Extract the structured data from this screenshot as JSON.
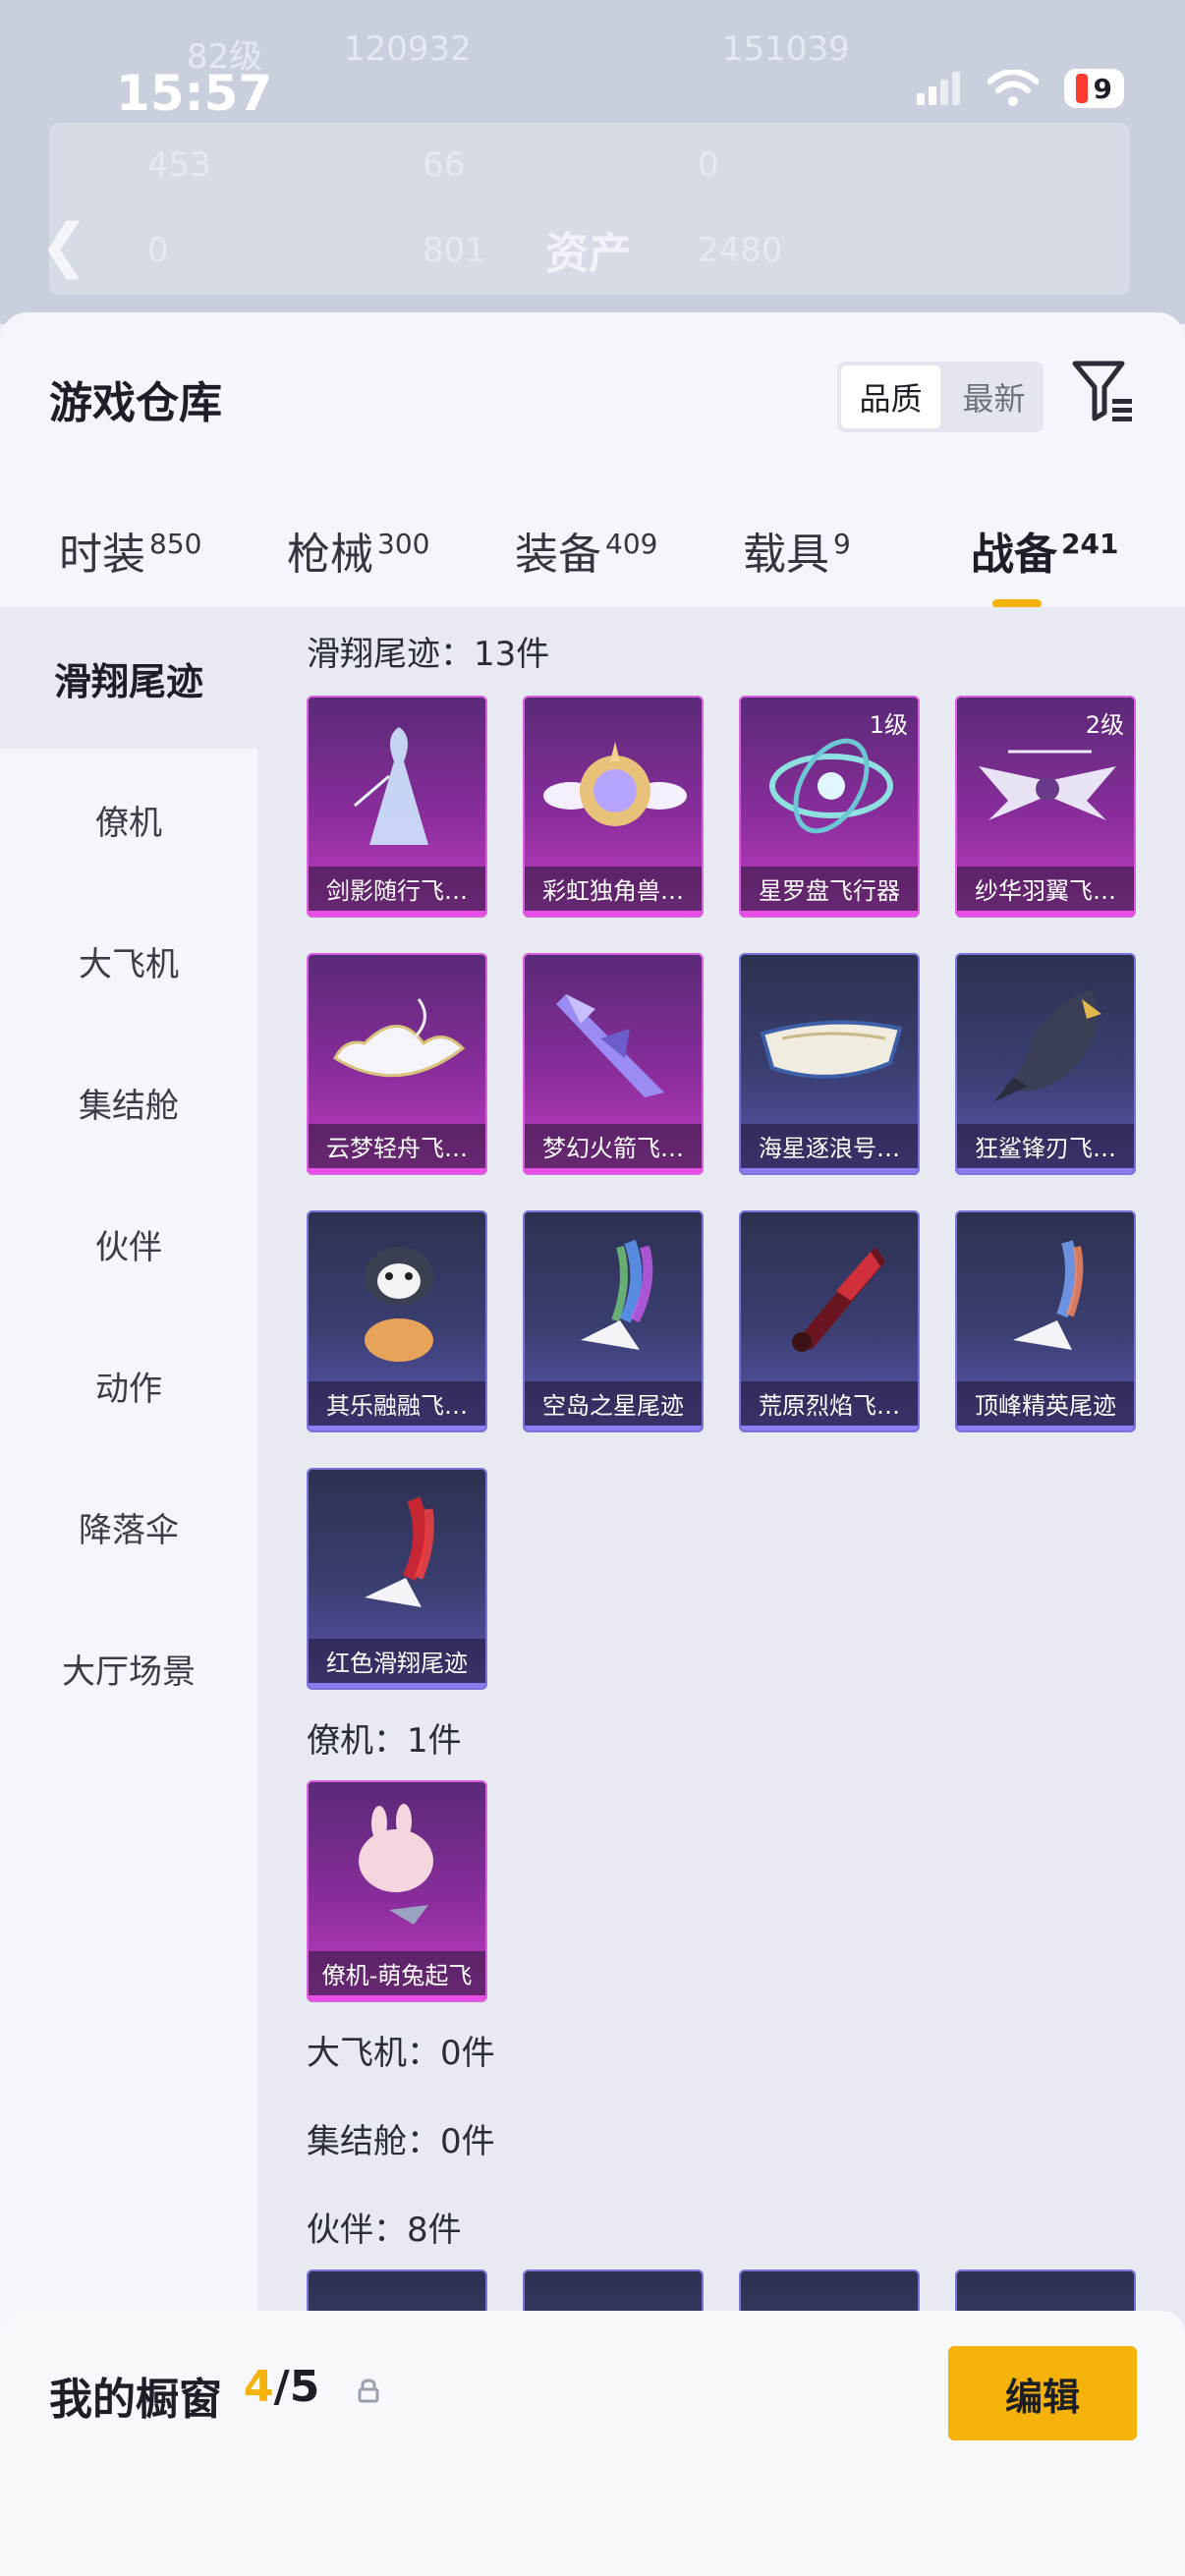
{
  "status": {
    "time": "15:57",
    "battery": "9"
  },
  "background": {
    "title": "资产",
    "faint_values": [
      "82级",
      "120932",
      "151039",
      "453",
      "66",
      "0",
      "0",
      "801",
      "2480"
    ]
  },
  "sheet": {
    "title": "游戏仓库",
    "sort": {
      "quality": "品质",
      "newest": "最新"
    }
  },
  "tabs": [
    {
      "label": "时装",
      "count": "850"
    },
    {
      "label": "枪械",
      "count": "300"
    },
    {
      "label": "装备",
      "count": "409"
    },
    {
      "label": "载具",
      "count": "9"
    },
    {
      "label": "战备",
      "count": "241"
    }
  ],
  "sidebar": [
    "滑翔尾迹",
    "僚机",
    "大飞机",
    "集结舱",
    "伙伴",
    "动作",
    "降落伞",
    "大厅场景"
  ],
  "sections": {
    "glide": {
      "title": "滑翔尾迹：13件",
      "items": [
        {
          "name": "剑影随行飞…",
          "level": ""
        },
        {
          "name": "彩虹独角兽…",
          "level": ""
        },
        {
          "name": "星罗盘飞行器",
          "level": "1级"
        },
        {
          "name": "纱华羽翼飞…",
          "level": "2级"
        },
        {
          "name": "云梦轻舟飞…",
          "level": ""
        },
        {
          "name": "梦幻火箭飞…",
          "level": ""
        },
        {
          "name": "海星逐浪号…",
          "level": ""
        },
        {
          "name": "狂鲨锋刃飞…",
          "level": ""
        },
        {
          "name": "其乐融融飞…",
          "level": ""
        },
        {
          "name": "空岛之星尾迹",
          "level": ""
        },
        {
          "name": "荒原烈焰飞…",
          "level": ""
        },
        {
          "name": "顶峰精英尾迹",
          "level": ""
        },
        {
          "name": "红色滑翔尾迹",
          "level": ""
        }
      ]
    },
    "wingman": {
      "title": "僚机：1件",
      "items": [
        {
          "name": "僚机-萌兔起飞"
        }
      ]
    },
    "plane": {
      "title": "大飞机：0件"
    },
    "pod": {
      "title": "集结舱：0件"
    },
    "partner": {
      "title": "伙伴：8件"
    }
  },
  "showcase": {
    "label": "我的橱窗",
    "current": "4",
    "total": "/5",
    "edit": "编辑"
  },
  "colors": {
    "accent": "#f5b20a",
    "epic_purple": "#c63fc6",
    "rare_blue": "#5d57b5"
  }
}
